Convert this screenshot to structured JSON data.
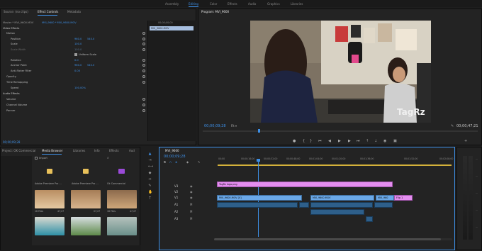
{
  "workspace_tabs": [
    "Assembly",
    "Editing",
    "Color",
    "Effects",
    "Audio",
    "Graphics",
    "Libraries"
  ],
  "workspace_active": "Editing",
  "effect_controls": {
    "tabs": [
      "Source: (no clips)",
      "Effect Controls",
      "Metadata"
    ],
    "breadcrumb": "Master * MVI_9600.MOV",
    "breadcrumb2": "MVI_9600 * MVI_9600.MOV",
    "mini_timecode": "00;00;00;00",
    "mini_clip": "MVI_9600.MOV",
    "section_video": "Video Effects",
    "props": [
      {
        "name": "Motion",
        "v1": "",
        "v2": ""
      },
      {
        "name": "Position",
        "v1": "960.0",
        "v2": "540.0"
      },
      {
        "name": "Scale",
        "v1": "100.0",
        "v2": ""
      },
      {
        "name": "Scale Width",
        "v1": "100.0",
        "v2": ""
      },
      {
        "name": "Uniform Scale",
        "v1": "",
        "v2": ""
      },
      {
        "name": "Rotation",
        "v1": "0.0",
        "v2": ""
      },
      {
        "name": "Anchor Point",
        "v1": "960.0",
        "v2": "540.0"
      },
      {
        "name": "Anti-flicker Filter",
        "v1": "0.00",
        "v2": ""
      },
      {
        "name": "Opacity",
        "v1": "",
        "v2": ""
      },
      {
        "name": "Time Remapping",
        "v1": "",
        "v2": ""
      },
      {
        "name": "Speed",
        "v1": "100.00%",
        "v2": ""
      }
    ],
    "section_audio": "Audio Effects",
    "audio_props": [
      "Volume",
      "Channel Volume",
      "Panner"
    ],
    "timecode": "00;00;09;28"
  },
  "program": {
    "title": "Program: MVI_9600",
    "timecode_left": "00;00;09;28",
    "fit": "Fit",
    "timecode_right": "00;00;47;21",
    "overlay_text": "TagRz"
  },
  "project": {
    "tabs": [
      "Project: OK Commercial",
      "Media Browser",
      "Libraries",
      "Info",
      "Effects",
      "Aud"
    ],
    "import_label": "Import",
    "items": [
      {
        "name": "Adobe Premiere Pro ...",
        "info": ""
      },
      {
        "name": "Adobe Premiere Pro ...",
        "info": ""
      },
      {
        "name": "Ok Commercial",
        "info": ""
      },
      {
        "name": "16 Files",
        "info": "47;27"
      },
      {
        "name": "",
        "info": "07;27"
      },
      {
        "name": "16 Files",
        "info": "47;27"
      }
    ]
  },
  "timeline": {
    "tab": "MVI_9600",
    "timecode": "00;00;09;28",
    "ruler": [
      "00;00",
      "00;00;16;00",
      "00;00;32;00",
      "00;00;48;00",
      "00;01;04;00",
      "00;01;20;00",
      "00;01;36;00",
      "00;01;52;00",
      "00;02;08;00"
    ],
    "video_tracks": [
      "V3",
      "V2",
      "V1"
    ],
    "audio_tracks": [
      "A1",
      "A2",
      "A3"
    ],
    "clips": {
      "graphic": "TagRz logo.png",
      "v1_a": "MVI_9600.MOV [V]",
      "v1_b": "MVI_9600.MOV",
      "v1_c": "MVI_960",
      "v1_d": "Flip 1"
    }
  },
  "colors": {
    "accent": "#3d8fe6",
    "video_clip": "#6aa8e8",
    "graphic_clip": "#e48ef0",
    "audio_clip": "#2e5f8a"
  }
}
